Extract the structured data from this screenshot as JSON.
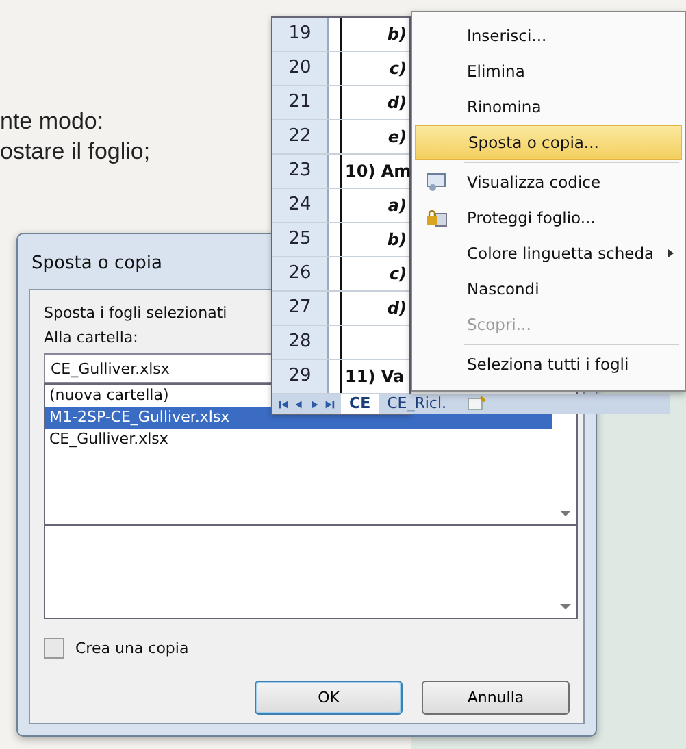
{
  "page_text": [
    "nte modo:",
    "ostare il foglio;"
  ],
  "sheet": {
    "rows": [
      {
        "number": "19",
        "cell": "b)",
        "kind": "item"
      },
      {
        "number": "20",
        "cell": "c)",
        "kind": "item"
      },
      {
        "number": "21",
        "cell": "d)",
        "kind": "item"
      },
      {
        "number": "22",
        "cell": "e)",
        "kind": "item"
      },
      {
        "number": "23",
        "cell": "10) Am",
        "kind": "heading"
      },
      {
        "number": "24",
        "cell": "a)",
        "kind": "item"
      },
      {
        "number": "25",
        "cell": "b)",
        "kind": "item"
      },
      {
        "number": "26",
        "cell": "c)",
        "kind": "item"
      },
      {
        "number": "27",
        "cell": "d)",
        "kind": "item"
      },
      {
        "number": "28"
      },
      {
        "number": "29",
        "cell": "11) Va",
        "kind": "heading"
      }
    ],
    "tabs": [
      {
        "label": "CE",
        "selected": true
      },
      {
        "label": "CE_Ricl.",
        "selected": false
      }
    ]
  },
  "context_menu": {
    "items": [
      {
        "label": "Inserisci...",
        "selected": false,
        "disabled": false,
        "kind": "plain"
      },
      {
        "label": "Elimina",
        "selected": false,
        "disabled": false,
        "kind": "plain"
      },
      {
        "label": "Rinomina",
        "selected": false,
        "disabled": false,
        "kind": "plain"
      },
      {
        "label": "Sposta o copia...",
        "selected": true,
        "disabled": false,
        "kind": "plain"
      },
      {
        "label": "Visualizza codice",
        "selected": false,
        "disabled": false,
        "kind": "code",
        "separator_before": true
      },
      {
        "label": "Proteggi foglio...",
        "selected": false,
        "disabled": false,
        "kind": "lock"
      },
      {
        "label": "Colore linguetta scheda",
        "selected": false,
        "disabled": false,
        "kind": "plain",
        "submenu": true
      },
      {
        "label": "Nascondi",
        "selected": false,
        "disabled": false,
        "kind": "plain"
      },
      {
        "label": "Scopri...",
        "selected": false,
        "disabled": true,
        "kind": "plain"
      },
      {
        "label": "Seleziona tutti i fogli",
        "selected": false,
        "disabled": false,
        "kind": "plain",
        "separator_before": true
      }
    ]
  },
  "dialog": {
    "title": "Sposta o copia",
    "heading": "Sposta i fogli selezionati",
    "folder_label": "Alla cartella:",
    "folder_value": "CE_Gulliver.xlsx",
    "folder_options": [
      {
        "label": "(nuova cartella)",
        "selected": false
      },
      {
        "label": "M1-2SP-CE_Gulliver.xlsx",
        "selected": true
      },
      {
        "label": "CE_Gulliver.xlsx",
        "selected": false
      }
    ],
    "copy_checkbox": {
      "label": "Crea una copia",
      "checked": false
    },
    "buttons": [
      {
        "label": "OK",
        "default": true
      },
      {
        "label": "Annulla",
        "default": false
      }
    ]
  }
}
